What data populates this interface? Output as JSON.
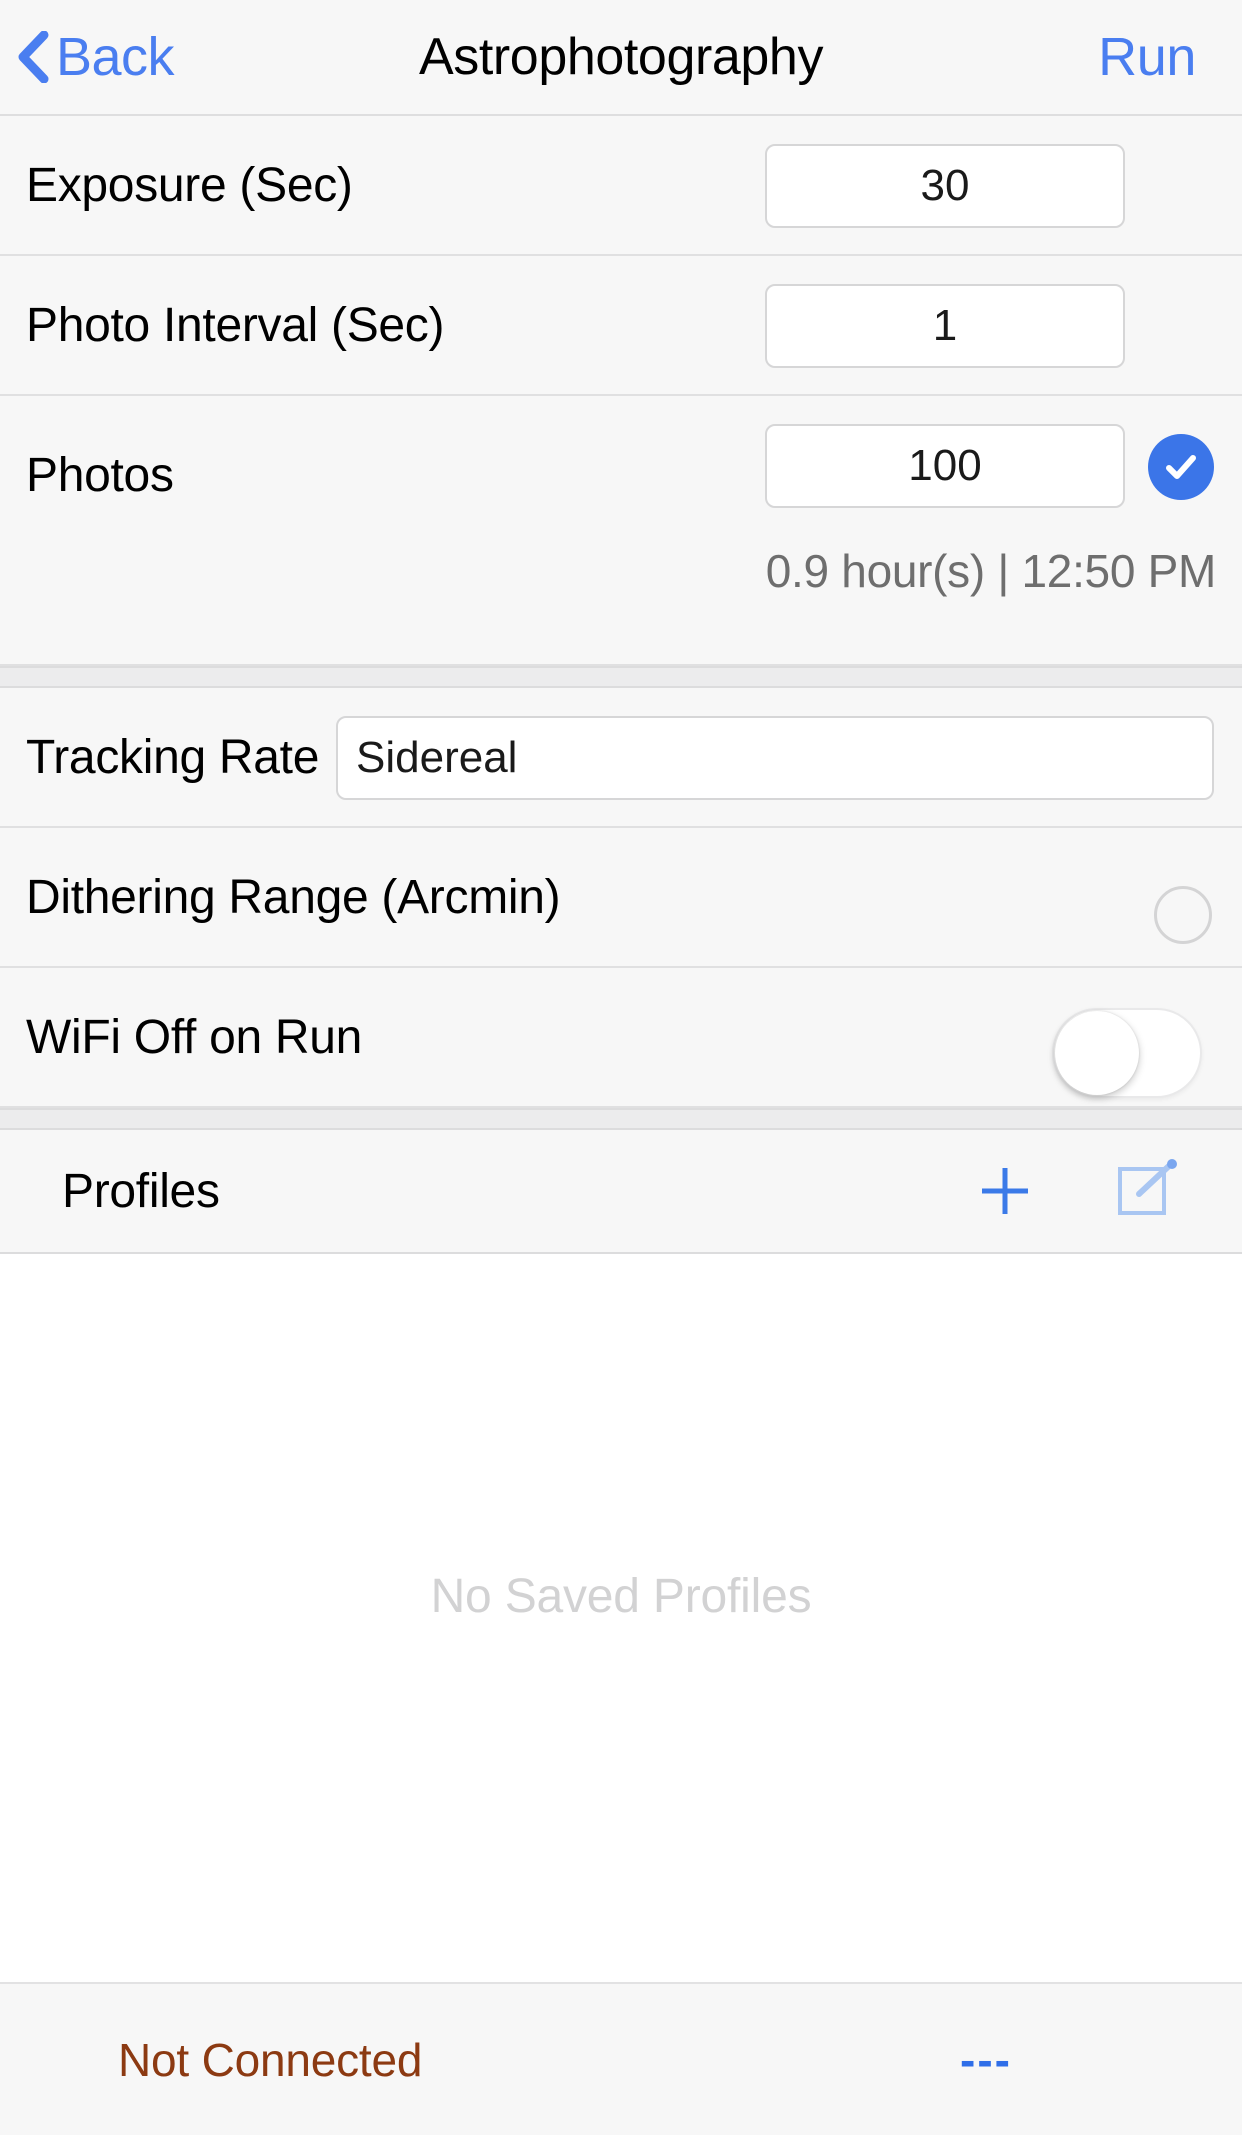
{
  "navbar": {
    "back_label": "Back",
    "back_icon": "chevron-left-icon",
    "title": "Astrophotography",
    "run_label": "Run"
  },
  "settings": {
    "rows": [
      {
        "label": "Exposure (Sec)",
        "value": "30"
      },
      {
        "label": "Photo Interval (Sec)",
        "value": "1"
      },
      {
        "label": "Photos",
        "value": "100"
      }
    ],
    "photos_confirm_icon": "check-circle-icon",
    "photos_caption": "0.9 hour(s) | 12:50 PM"
  },
  "options": {
    "tracking_rate": {
      "label": "Tracking Rate",
      "value": "Sidereal"
    },
    "dithering": {
      "label": "Dithering Range (Arcmin)",
      "control_icon": "empty-circle-icon",
      "value": ""
    },
    "wifi_off": {
      "label": "WiFi Off on Run",
      "state": "off"
    }
  },
  "profiles": {
    "title": "Profiles",
    "add_icon": "plus-icon",
    "edit_icon": "compose-edit-icon",
    "empty_message": "No Saved Profiles"
  },
  "statusbar": {
    "connection": "Not Connected",
    "indicator": "---"
  },
  "colors": {
    "accent_blue": "#4a7ef0",
    "badge_blue": "#3b75e8",
    "status_brown": "#8c3a12",
    "status_blue": "#2f6ee8",
    "row_bg": "#f7f7f7",
    "placeholder_gray": "#d2d2d3"
  }
}
